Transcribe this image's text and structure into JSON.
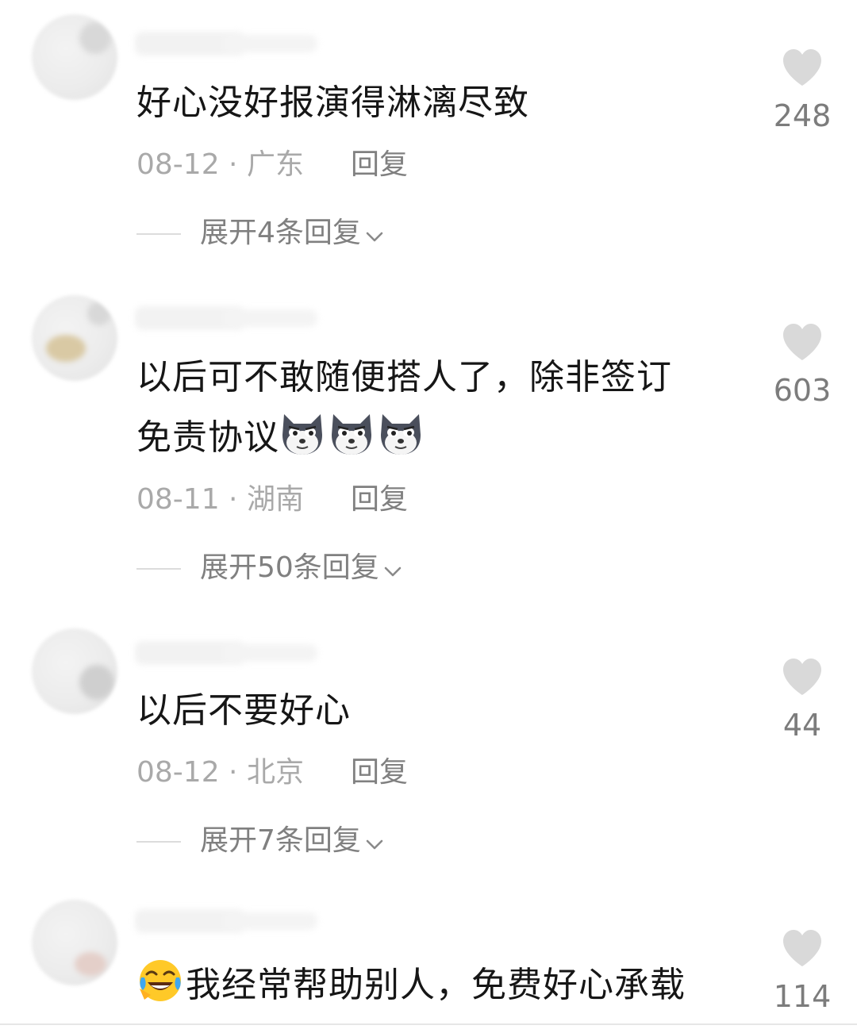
{
  "comments": [
    {
      "text": "好心没好报演得淋漓尽致",
      "date_location": "08-12 · 广东",
      "reply_label": "回复",
      "expand_label": "展开4条回复",
      "likes": "248"
    },
    {
      "text_line1": "以后可不敢随便搭人了，除非签订",
      "text_line2": "免责协议",
      "date_location": "08-11 · 湖南",
      "reply_label": "回复",
      "expand_label": "展开50条回复",
      "likes": "603"
    },
    {
      "text": "以后不要好心",
      "date_location": "08-12 · 北京",
      "reply_label": "回复",
      "expand_label": "展开7条回复",
      "likes": "44"
    },
    {
      "text": "我经常帮助别人，免费好心承载",
      "likes": "114"
    }
  ],
  "icons": {
    "like": "heart-icon",
    "expand": "chevron-down-icon",
    "emoji_dog": "doge-emoji",
    "emoji_laugh": "laughing-tears-emoji"
  },
  "colors": {
    "text": "#161616",
    "meta": "#a9a9a9",
    "secondary": "#808080",
    "heart": "#d9d9d9"
  }
}
